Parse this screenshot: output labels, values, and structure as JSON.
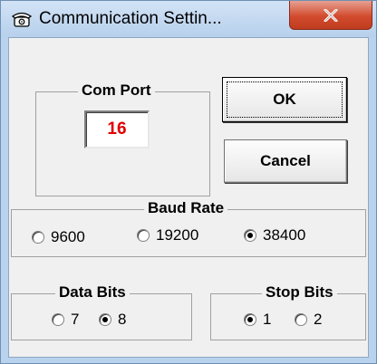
{
  "window": {
    "title": "Communication Settin...",
    "close_glyph": "X"
  },
  "com_port": {
    "label": "Com Port",
    "value": "16",
    "value_color": "#e00000"
  },
  "buttons": {
    "ok_label": "OK",
    "cancel_label": "Cancel"
  },
  "baud_rate": {
    "label": "Baud Rate",
    "options": [
      "9600",
      "19200",
      "38400"
    ],
    "selected": "38400"
  },
  "data_bits": {
    "label": "Data Bits",
    "options": [
      "7",
      "8"
    ],
    "selected": "8"
  },
  "stop_bits": {
    "label": "Stop Bits",
    "options": [
      "1",
      "2"
    ],
    "selected": "1"
  },
  "icons": {
    "title_icon": "telephone-icon",
    "close_icon": "close-icon"
  }
}
